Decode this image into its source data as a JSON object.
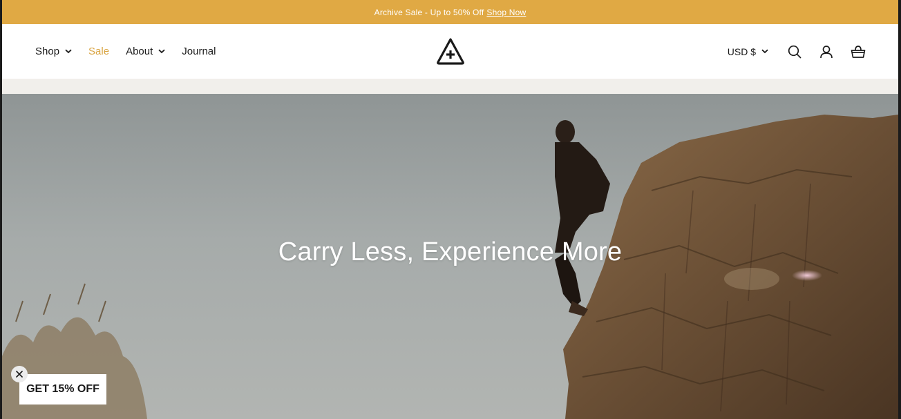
{
  "announcement": {
    "text": "Archive Sale - Up to 50% Off",
    "link": "Shop Now"
  },
  "nav": {
    "items": [
      {
        "label": "Shop",
        "has_dropdown": true
      },
      {
        "label": "Sale",
        "has_dropdown": false
      },
      {
        "label": "About",
        "has_dropdown": true
      },
      {
        "label": "Journal",
        "has_dropdown": false
      }
    ]
  },
  "header": {
    "logo_icon": "triangle-plus-logo",
    "currency": "USD $",
    "icons": [
      "search-icon",
      "account-icon",
      "cart-icon"
    ]
  },
  "hero": {
    "title": "Carry Less, Experience More"
  },
  "promo": {
    "label": "GET 15% OFF"
  },
  "colors": {
    "announcement_bg": "#e0a944",
    "sale_text": "#d9a441",
    "strip_bg": "#f1efeb"
  }
}
